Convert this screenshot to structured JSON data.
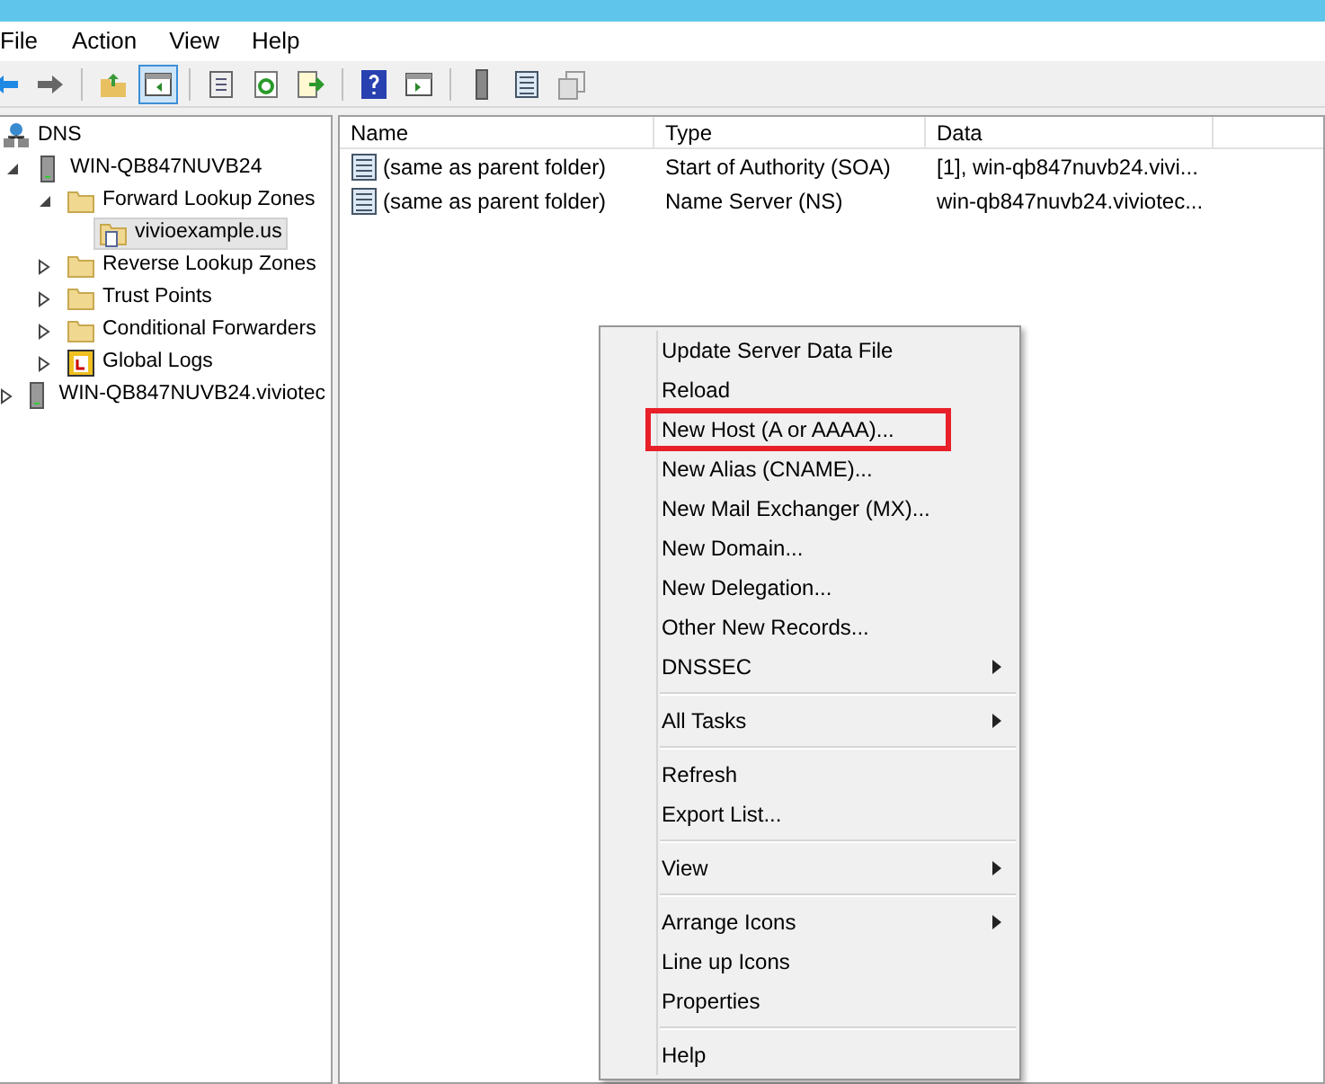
{
  "menu_bar": [
    "File",
    "Action",
    "View",
    "Help"
  ],
  "toolbar": [
    {
      "kind": "back",
      "selected": false
    },
    {
      "kind": "forward",
      "selected": false
    },
    {
      "kind": "sep"
    },
    {
      "kind": "up",
      "selected": false
    },
    {
      "kind": "console-tree",
      "selected": true
    },
    {
      "kind": "sep"
    },
    {
      "kind": "properties",
      "selected": false
    },
    {
      "kind": "refresh",
      "selected": false
    },
    {
      "kind": "export",
      "selected": false
    },
    {
      "kind": "sep"
    },
    {
      "kind": "help",
      "selected": false
    },
    {
      "kind": "action-pane",
      "selected": false
    },
    {
      "kind": "sep"
    },
    {
      "kind": "server",
      "selected": false
    },
    {
      "kind": "records",
      "selected": false
    },
    {
      "kind": "copy",
      "selected": false
    }
  ],
  "tree": [
    {
      "label": "DNS",
      "kind": "dns",
      "selected": false,
      "children": [
        {
          "label": "WIN-QB847NUVB24",
          "kind": "server",
          "expanded": true,
          "selected": false,
          "children": [
            {
              "label": "Forward Lookup Zones",
              "kind": "folder",
              "expanded": true,
              "selected": false,
              "children": [
                {
                  "label": "vivioexample.us",
                  "kind": "zone",
                  "selected": true
                }
              ]
            },
            {
              "label": "Reverse Lookup Zones",
              "kind": "folder",
              "expanded": false,
              "selected": false
            },
            {
              "label": "Trust Points",
              "kind": "folder",
              "expanded": false,
              "selected": false
            },
            {
              "label": "Conditional Forwarders",
              "kind": "folder",
              "expanded": false,
              "selected": false
            },
            {
              "label": "Global Logs",
              "kind": "log",
              "expanded": false,
              "selected": false
            }
          ]
        },
        {
          "label": "WIN-QB847NUVB24.viviotec",
          "kind": "server",
          "expanded": false,
          "selected": false
        }
      ]
    }
  ],
  "table": {
    "columns": [
      "Name",
      "Type",
      "Data"
    ],
    "rows": [
      [
        "(same as parent folder)",
        "Start of Authority (SOA)",
        "[1], win-qb847nuvb24.vivi..."
      ],
      [
        "(same as parent folder)",
        "Name Server (NS)",
        "win-qb847nuvb24.viviotec..."
      ]
    ]
  },
  "context_menu": [
    {
      "kind": "item",
      "label": "Update Server Data File",
      "submenu": false,
      "highlighted": false
    },
    {
      "kind": "item",
      "label": "Reload",
      "submenu": false,
      "highlighted": false
    },
    {
      "kind": "item",
      "label": "New Host (A or AAAA)...",
      "submenu": false,
      "highlighted": true
    },
    {
      "kind": "item",
      "label": "New Alias (CNAME)...",
      "submenu": false,
      "highlighted": false
    },
    {
      "kind": "item",
      "label": "New Mail Exchanger (MX)...",
      "submenu": false,
      "highlighted": false
    },
    {
      "kind": "item",
      "label": "New Domain...",
      "submenu": false,
      "highlighted": false
    },
    {
      "kind": "item",
      "label": "New Delegation...",
      "submenu": false,
      "highlighted": false
    },
    {
      "kind": "item",
      "label": "Other New Records...",
      "submenu": false,
      "highlighted": false
    },
    {
      "kind": "item",
      "label": "DNSSEC",
      "submenu": true,
      "highlighted": false
    },
    {
      "kind": "separator"
    },
    {
      "kind": "item",
      "label": "All Tasks",
      "submenu": true,
      "highlighted": false
    },
    {
      "kind": "separator"
    },
    {
      "kind": "item",
      "label": "Refresh",
      "submenu": false,
      "highlighted": false
    },
    {
      "kind": "item",
      "label": "Export List...",
      "submenu": false,
      "highlighted": false
    },
    {
      "kind": "separator"
    },
    {
      "kind": "item",
      "label": "View",
      "submenu": true,
      "highlighted": false
    },
    {
      "kind": "separator"
    },
    {
      "kind": "item",
      "label": "Arrange Icons",
      "submenu": true,
      "highlighted": false
    },
    {
      "kind": "item",
      "label": "Line up Icons",
      "submenu": false,
      "highlighted": false
    },
    {
      "kind": "item",
      "label": "Properties",
      "submenu": false,
      "highlighted": false
    },
    {
      "kind": "separator"
    },
    {
      "kind": "item",
      "label": "Help",
      "submenu": false,
      "highlighted": false
    }
  ]
}
